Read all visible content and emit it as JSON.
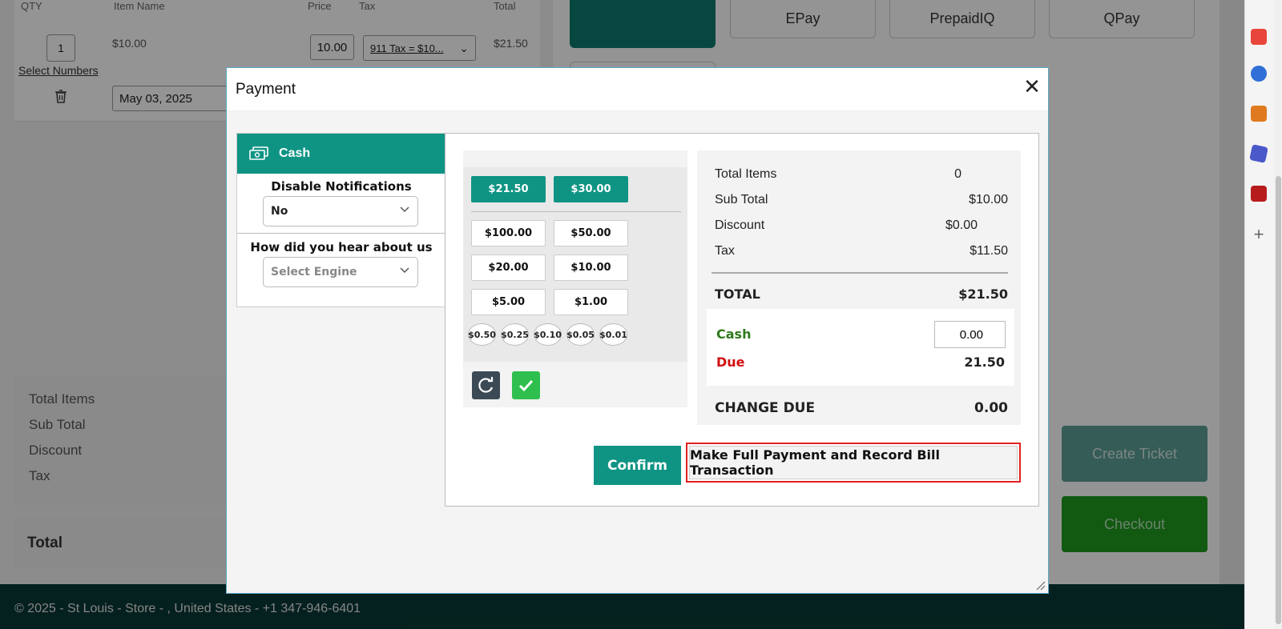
{
  "background": {
    "columns": {
      "qty": "QTY",
      "item_name": "Item Name",
      "price": "Price",
      "tax": "Tax",
      "total": "Total"
    },
    "line_item": {
      "qty": "1",
      "item": "$10.00",
      "price": "10.00",
      "tax": "911 Tax = $10...",
      "total": "$21.50",
      "select_numbers": "Select Numbers",
      "date": "May 03, 2025"
    },
    "summary_labels": [
      "Total Items",
      "Sub Total",
      "Discount",
      "Tax"
    ],
    "total_label": "Total",
    "payment_methods": [
      "EPay",
      "PrepaidIQ",
      "QPay"
    ],
    "create_ticket": "Create Ticket",
    "checkout": "Checkout",
    "footer": "© 2025 - St Louis - Store - , United States - +1 347-946-6401"
  },
  "modal": {
    "title": "Payment",
    "tab": "Cash",
    "notifications": {
      "label": "Disable Notifications",
      "value": "No"
    },
    "hear_about": {
      "label": "How did you hear about us",
      "placeholder": "Select Engine"
    },
    "quick_amounts": [
      "$21.50",
      "$30.00"
    ],
    "bills": [
      "$100.00",
      "$50.00",
      "$20.00",
      "$10.00",
      "$5.00",
      "$1.00"
    ],
    "coins": [
      "$0.50",
      "$0.25",
      "$0.10",
      "$0.05",
      "$0.01"
    ],
    "summary": {
      "total_items": {
        "label": "Total Items",
        "value": "0"
      },
      "sub_total": {
        "label": "Sub Total",
        "value": "$10.00"
      },
      "discount": {
        "label": "Discount",
        "value": "$0.00"
      },
      "tax": {
        "label": "Tax",
        "value": "$11.50"
      },
      "total": {
        "label": "TOTAL",
        "value": "$21.50"
      },
      "cash": {
        "label": "Cash",
        "value": "0.00"
      },
      "due": {
        "label": "Due",
        "value": "21.50"
      },
      "change_due": {
        "label": "CHANGE DUE",
        "value": "0.00"
      }
    },
    "confirm": "Confirm",
    "full_payment": "Make Full Payment and Record Bill Transaction"
  },
  "colors": {
    "teal": "#0f9484",
    "highlight": "#e02020",
    "cash": "#2e7a1a",
    "due": "#d01010"
  }
}
